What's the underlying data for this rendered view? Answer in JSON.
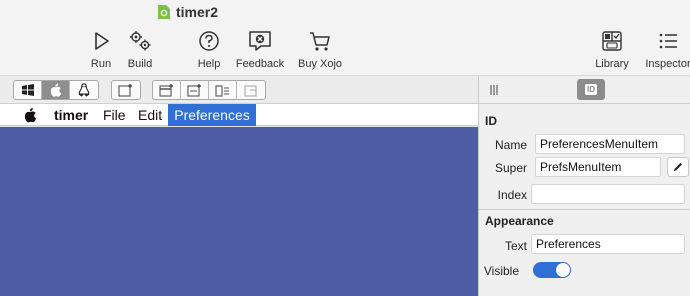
{
  "window": {
    "title": "timer2"
  },
  "toolbar": {
    "run": "Run",
    "build": "Build",
    "help": "Help",
    "feedback": "Feedback",
    "buy": "Buy Xojo",
    "library": "Library",
    "inspector": "Inspector"
  },
  "editor": {
    "menubar": {
      "app": "timer",
      "items": [
        "File",
        "Edit",
        "Preferences"
      ],
      "selected": "Preferences"
    },
    "canvas_color": "#4e5ea6"
  },
  "inspector": {
    "id_section": "ID",
    "name_label": "Name",
    "name_value": "PreferencesMenuItem",
    "super_label": "Super",
    "super_value": "PrefsMenuItem",
    "index_label": "Index",
    "index_value": "",
    "appearance_section": "Appearance",
    "text_label": "Text",
    "text_value": "Preferences",
    "visible_label": "Visible",
    "visible_value": true
  },
  "colors": {
    "accent": "#2f6fd6",
    "app_icon": "#7cc04a"
  },
  "icons": [
    "document-icon",
    "run-icon",
    "build-icon",
    "help-icon",
    "feedback-icon",
    "cart-icon",
    "library-icon",
    "inspector-icon",
    "windows-icon",
    "apple-icon",
    "linux-icon",
    "add-menu-icon",
    "add-menu-item-icon",
    "add-submenu-icon",
    "add-separator-icon",
    "move-item-icon",
    "columns-icon",
    "id-icon",
    "pencil-icon"
  ]
}
